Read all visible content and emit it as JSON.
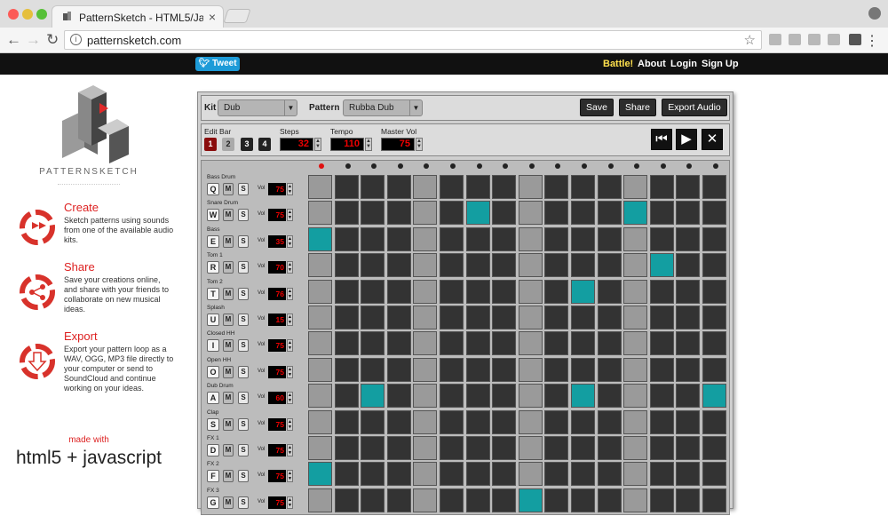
{
  "browser": {
    "tab_title": "PatternSketch - HTML5/JavaScript",
    "url": "patternsketch.com",
    "traffic_lights": [
      "#fc5b57",
      "#e5bf3c",
      "#57c038"
    ]
  },
  "site": {
    "tweet_label": "Tweet",
    "nav": [
      "Battle!",
      "About",
      "Login",
      "Sign Up"
    ],
    "battle_color": "#ffe14d"
  },
  "sidebar": {
    "logo_text": "PATTERNSKETCH",
    "features": [
      {
        "title": "Create",
        "desc": "Sketch patterns using sounds from one of the available audio kits."
      },
      {
        "title": "Share",
        "desc": "Save your creations online, and share with your friends to collaborate on new musical ideas."
      },
      {
        "title": "Export",
        "desc": "Export your pattern loop as a WAV, OGG, MP3 file directly to your computer or send to SoundCloud and continue working on your ideas."
      }
    ],
    "made_with": "made with",
    "tech": "html5 + javascript"
  },
  "controls": {
    "kit_label": "Kit",
    "kit_value": "Dub",
    "pattern_label": "Pattern",
    "pattern_value": "Rubba Dub",
    "save": "Save",
    "share": "Share",
    "export": "Export Audio",
    "edit_bar_label": "Edit Bar",
    "bars": [
      "1",
      "2",
      "3",
      "4"
    ],
    "active_bar": 1,
    "steps_label": "Steps",
    "steps": "32",
    "tempo_label": "Tempo",
    "tempo": "110",
    "master_label": "Master Vol",
    "master": "75"
  },
  "transport": {
    "icons": [
      "rewind-icon",
      "play-icon",
      "stop-icon"
    ]
  },
  "sequencer": {
    "current_step": 1,
    "step_count": 16,
    "tracks": [
      {
        "name": "Bass Drum",
        "key": "Q",
        "vol": "75",
        "steps": []
      },
      {
        "name": "Snare Drum",
        "key": "W",
        "vol": "75",
        "steps": [
          7,
          13
        ]
      },
      {
        "name": "Bass",
        "key": "E",
        "vol": "35",
        "steps": [
          1
        ]
      },
      {
        "name": "Tom 1",
        "key": "R",
        "vol": "70",
        "steps": [
          14
        ]
      },
      {
        "name": "Tom 2",
        "key": "T",
        "vol": "76",
        "steps": [
          11
        ]
      },
      {
        "name": "Splash",
        "key": "U",
        "vol": "15",
        "steps": []
      },
      {
        "name": "Closed HH",
        "key": "I",
        "vol": "75",
        "steps": []
      },
      {
        "name": "Open HH",
        "key": "O",
        "vol": "75",
        "steps": []
      },
      {
        "name": "Dub Drum",
        "key": "A",
        "vol": "60",
        "steps": [
          3,
          11,
          16
        ]
      },
      {
        "name": "Clap",
        "key": "S",
        "vol": "75",
        "steps": []
      },
      {
        "name": "FX 1",
        "key": "D",
        "vol": "75",
        "steps": []
      },
      {
        "name": "FX 2",
        "key": "F",
        "vol": "75",
        "steps": [
          1
        ]
      },
      {
        "name": "FX 3",
        "key": "G",
        "vol": "75",
        "steps": [
          9
        ]
      }
    ],
    "teal": "#139ea1"
  }
}
